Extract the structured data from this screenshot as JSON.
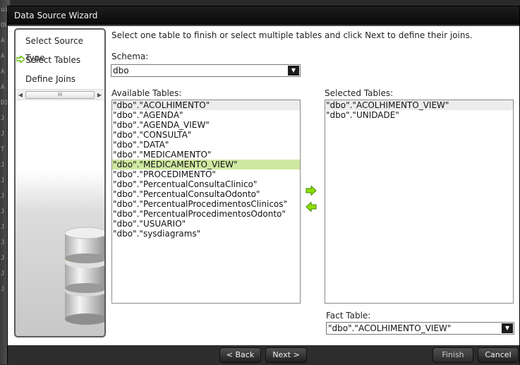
{
  "background": {
    "fragments": [
      "uid",
      "OU",
      "A",
      "A",
      "A",
      "A",
      "DI",
      "J",
      "J",
      "T",
      "J",
      "J",
      "J",
      "J",
      "J",
      "J",
      "J",
      "J",
      "J"
    ]
  },
  "window": {
    "title": "Data Source Wizard"
  },
  "steps": {
    "items": [
      {
        "label": "Select Source Type",
        "current": false
      },
      {
        "label": "Select Tables",
        "current": true
      },
      {
        "label": "Define Joins",
        "current": false
      }
    ],
    "scroll_grip": "III"
  },
  "main": {
    "instruction": "Select one table to finish or select multiple tables and click Next to define their joins.",
    "schema_label": "Schema:",
    "schema_value": "dbo",
    "available_label": "Available Tables:",
    "available_tables": [
      "\"dbo\".\"ACOLHIMENTO\"",
      "\"dbo\".\"AGENDA\"",
      "\"dbo\".\"AGENDA_VIEW\"",
      "\"dbo\".\"CONSULTA\"",
      "\"dbo\".\"DATA\"",
      "\"dbo\".\"MEDICAMENTO\"",
      "\"dbo\".\"MEDICAMENTO_VIEW\"",
      "\"dbo\".\"PROCEDIMENTO\"",
      "\"dbo\".\"PercentualConsultaClinico\"",
      "\"dbo\".\"PercentualConsultaOdonto\"",
      "\"dbo\".\"PercentualProcedimentosClinicos\"",
      "\"dbo\".\"PercentualProcedimentosOdonto\"",
      "\"dbo\".\"USUARIO\"",
      "\"dbo\".\"sysdiagrams\""
    ],
    "available_selected_index": 6,
    "selected_label": "Selected Tables:",
    "selected_tables": [
      "\"dbo\".\"ACOLHIMENTO_VIEW\"",
      "\"dbo\".\"UNIDADE\""
    ],
    "fact_label": "Fact Table:",
    "fact_value": "\"dbo\".\"ACOLHIMENTO_VIEW\""
  },
  "icons": {
    "add": "arrow-right-icon",
    "remove": "arrow-left-icon",
    "current_step": "arrow-right-icon",
    "dropdown": "chevron-down-icon"
  },
  "colors": {
    "selection": "#cfe8a0",
    "arrow": "#5bb800",
    "title_bar": "#111111",
    "footer": "#2d2d2d"
  },
  "buttons": {
    "back": "< Back",
    "next": "Next >",
    "finish": "Finish",
    "cancel": "Cancel"
  }
}
